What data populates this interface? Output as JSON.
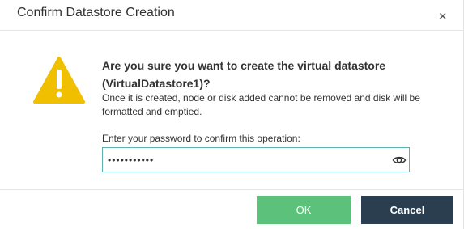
{
  "dialog": {
    "title": "Confirm Datastore Creation",
    "close_icon": "close-icon",
    "warning_icon": "warning-triangle-icon",
    "warning_color": "#f0bf00",
    "question": "Are you sure you want to create the virtual datastore (VirtualDatastore1)?",
    "detail": "Once it is created, node or disk added cannot be removed and disk will be formatted and emptied.",
    "password_label": "Enter your password to confirm this operation:",
    "password_value": "•••••••••••",
    "eye_icon": "eye-icon",
    "ok_label": "OK",
    "cancel_label": "Cancel",
    "ok_color": "#5cc17a",
    "cancel_color": "#2b3e50"
  }
}
